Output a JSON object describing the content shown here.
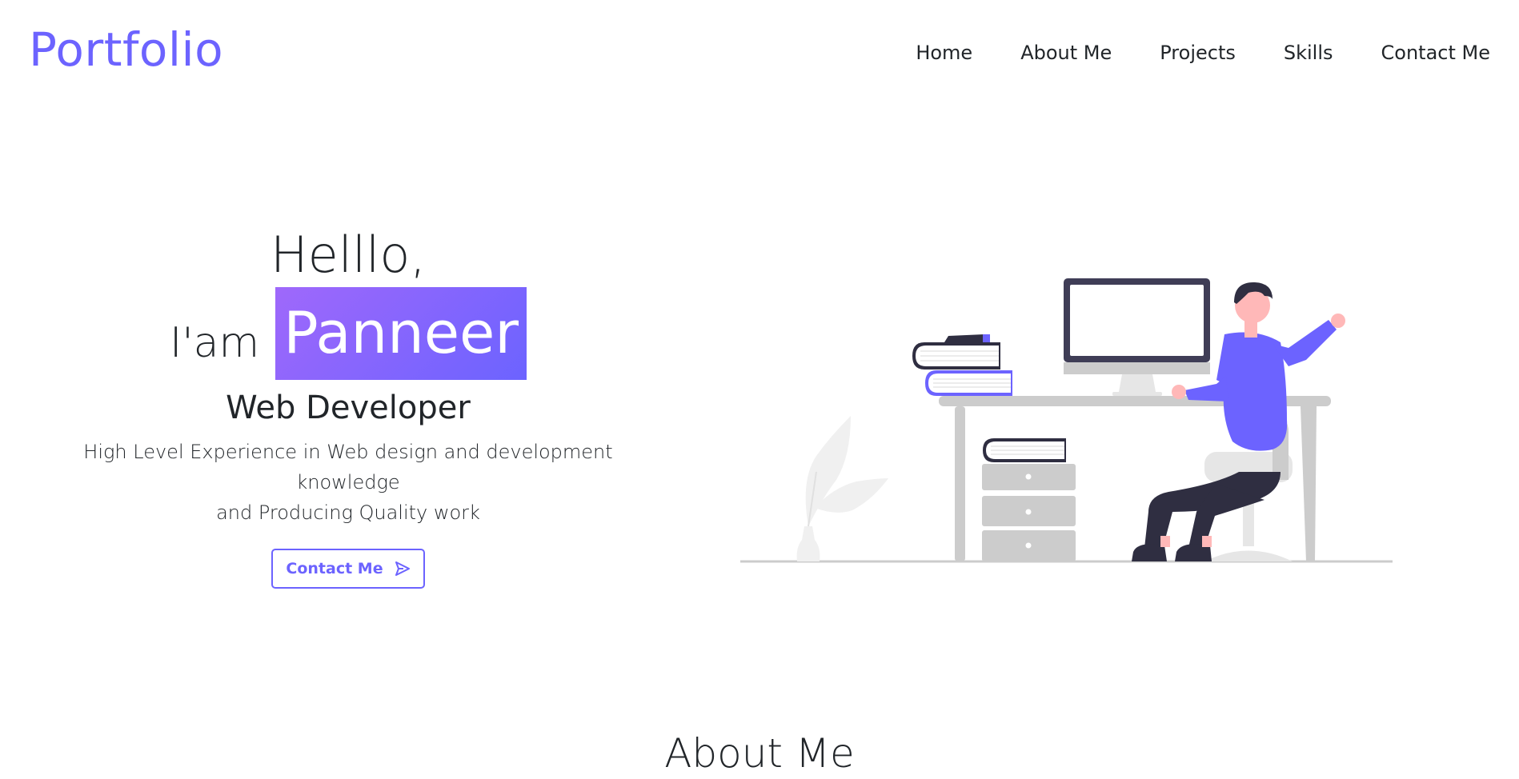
{
  "brand": "Portfolio",
  "nav": {
    "items": [
      "Home",
      "About Me",
      "Projects",
      "Skills",
      "Contact Me"
    ]
  },
  "hero": {
    "greeting": "Helllo,",
    "iam": "I'am",
    "name": "Panneer",
    "role": "Web Developer",
    "description_line1": "High Level Experience in Web design and development knowledge",
    "description_line2": "and Producing Quality work",
    "cta_label": "Contact Me",
    "cta_icon": "send-icon"
  },
  "about": {
    "title": "About Me"
  },
  "colors": {
    "accent": "#6c63ff",
    "gradient_start": "#9f68fb",
    "text": "#212529",
    "illustration_gray": "#cccccc",
    "illustration_dark": "#2f2e41",
    "skin": "#ffb8b8"
  }
}
